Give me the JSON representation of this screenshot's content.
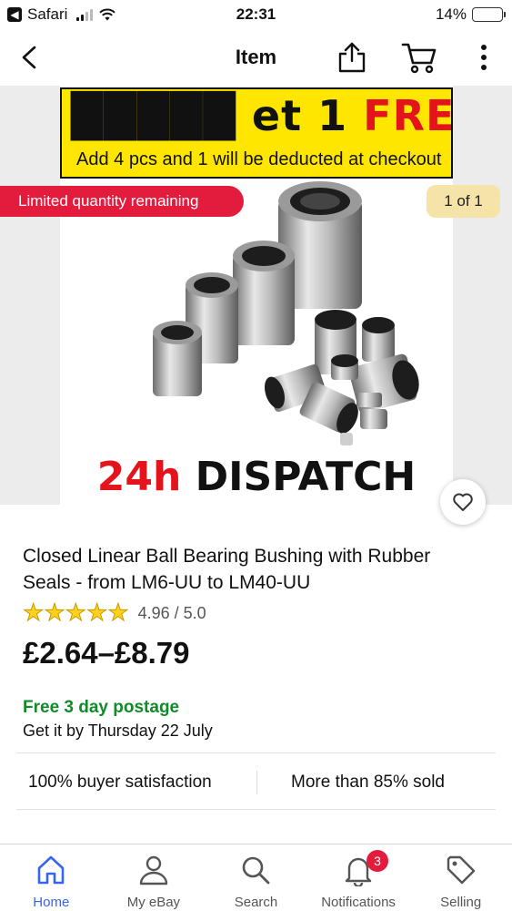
{
  "status_bar": {
    "back_app": "Safari",
    "time": "22:31",
    "battery": "14%"
  },
  "nav": {
    "title": "Item"
  },
  "hero": {
    "limited_badge": "Limited quantity remaining",
    "counter": "1 of 1",
    "promo_headline_visible": "et 1",
    "promo_headline_red": "FREE",
    "promo_subline": "Add 4 pcs  and 1 will be deducted at checkout",
    "dispatch_red": "24h",
    "dispatch_black": "DISPATCH"
  },
  "product": {
    "title": "Closed Linear Ball Bearing Bushing with Rubber Seals - from LM6-UU to LM40-UU",
    "rating_stars": 5,
    "rating_text": "4.96 / 5.0",
    "price": "£2.64–£8.79",
    "postage": "Free 3 day postage",
    "delivery": "Get it by Thursday 22 July",
    "stat_satisfaction": "100% buyer satisfaction",
    "stat_sold": "More than 85% sold"
  },
  "tabs": [
    {
      "label": "Home",
      "icon": "home-icon",
      "active": true
    },
    {
      "label": "My eBay",
      "icon": "person-icon",
      "active": false
    },
    {
      "label": "Search",
      "icon": "search-icon",
      "active": false
    },
    {
      "label": "Notifications",
      "icon": "bell-icon",
      "active": false,
      "badge": "3"
    },
    {
      "label": "Selling",
      "icon": "tag-icon",
      "active": false
    }
  ],
  "colors": {
    "accent": "#3665f3",
    "badge_red": "#e31c3d",
    "postage_green": "#118a29",
    "promo_yellow": "#ffe600"
  }
}
